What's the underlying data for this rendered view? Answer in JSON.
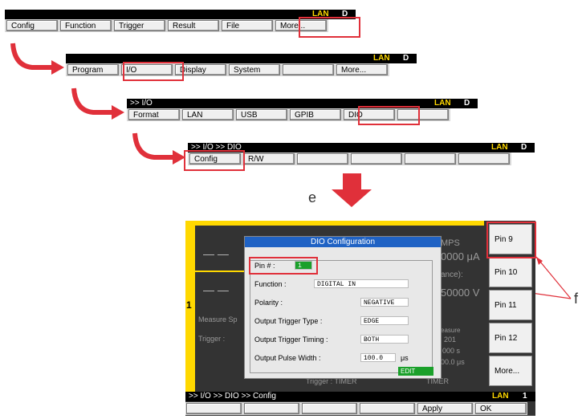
{
  "bar1": {
    "lan": "LAN",
    "d": "D",
    "keys": [
      "Config",
      "Function",
      "Trigger",
      "Result",
      "File",
      "More..."
    ]
  },
  "bar2": {
    "lan": "LAN",
    "d": "D",
    "keys": [
      "Program",
      "I/O",
      "Display",
      "System",
      "",
      "More..."
    ]
  },
  "bar3": {
    "path": ">> I/O",
    "lan": "LAN",
    "d": "D",
    "keys": [
      "Format",
      "LAN",
      "USB",
      "GPIB",
      "DIO",
      ""
    ]
  },
  "bar4": {
    "path": ">> I/O >> DIO",
    "lan": "LAN",
    "d": "D",
    "keys": [
      "Config",
      "R/W",
      "",
      "",
      "",
      ""
    ]
  },
  "label_e": "e",
  "label_f": "f",
  "screen": {
    "bg": {
      "mps": "MPS",
      "uA": "0000 μA",
      "ance": "ance):",
      "v": "50000 V",
      "measure": "Measure Sp",
      "trigger": "Trigger :",
      "easure": "easure",
      "n201": "201",
      "n000": "000 s",
      "us": "00.0 μs",
      "trig_line": "Trigger :  TIMER",
      "timer": "TIMER",
      "one": "1"
    },
    "dialog": {
      "title": "DIO Configuration",
      "pin_label": "Pin # :",
      "pin_value": "1",
      "rows": [
        {
          "label": "Function :",
          "value": "DIGITAL IN"
        },
        {
          "label": "Polarity :",
          "value": "NEGATIVE"
        },
        {
          "label": "Output Trigger Type :",
          "value": "EDGE"
        },
        {
          "label": "Output Trigger Timing :",
          "value": "BOTH"
        },
        {
          "label": "Output Pulse Width :",
          "value": "100.0",
          "unit": "μs"
        }
      ],
      "edit": "EDIT"
    },
    "softkeys": [
      "Pin 9",
      "Pin 10",
      "Pin 11",
      "Pin 12",
      "More..."
    ],
    "status": {
      "path": ">> I/O >> DIO >> Config",
      "lan": "LAN",
      "num": "1"
    },
    "bottom_keys": [
      "",
      "",
      "",
      "",
      "Apply",
      "OK"
    ]
  },
  "colors": {
    "highlight": "#e0303a",
    "lan": "#ffd800",
    "title": "#1f62c4",
    "edit": "#1aa02a"
  }
}
